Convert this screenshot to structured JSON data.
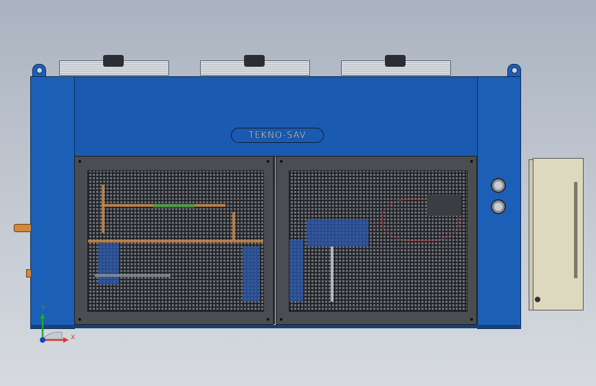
{
  "brand": {
    "logo_text": "TEKNO-SAV"
  },
  "triad": {
    "y_label": "Y",
    "x_label": "X"
  },
  "colors": {
    "body_blue": "#1c5fb6",
    "door_gray": "#4a4d52",
    "electrical_box": "#ddd9bf",
    "copper": "#c9894a",
    "background": "#c4cad3"
  },
  "icons": [
    "fan-icon",
    "lifting-lug-icon",
    "indicator-knob-icon",
    "axis-triad-icon"
  ]
}
